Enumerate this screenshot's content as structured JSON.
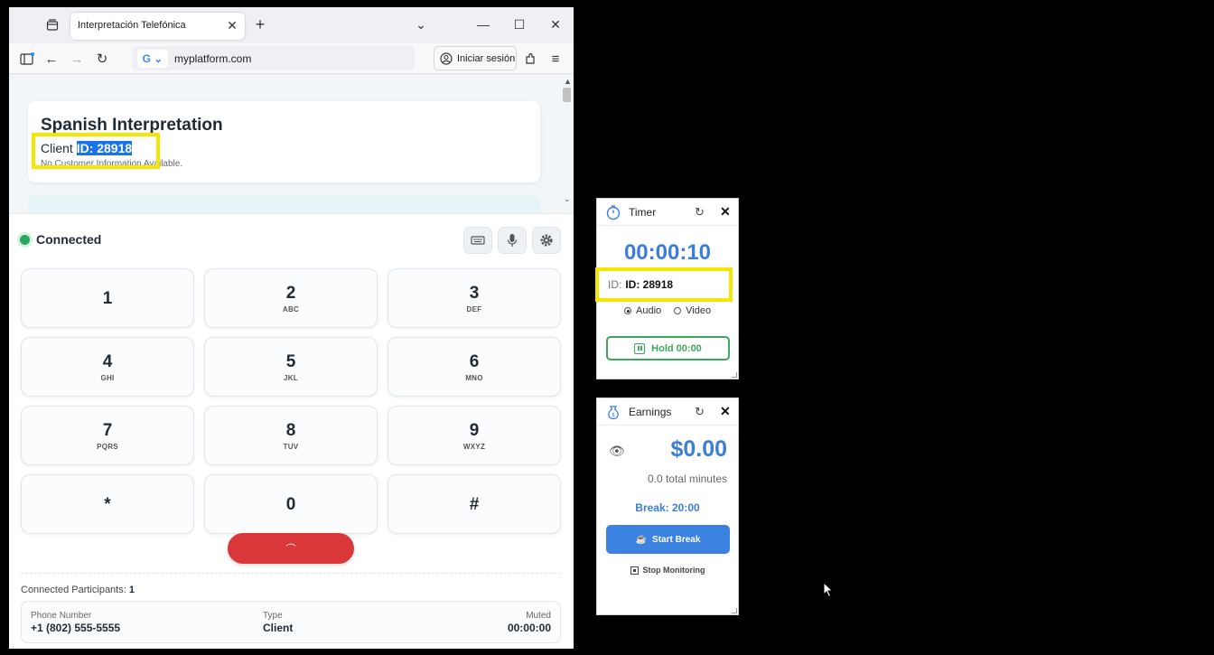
{
  "browser": {
    "tab_title": "Interpretación Telefónica",
    "url": "myplatform.com",
    "signin_label": "Iniciar sesión"
  },
  "page": {
    "title": "Spanish Interpretation",
    "client_prefix": "Client ",
    "client_id": "ID: 28918",
    "no_info": "No Customer Information Available."
  },
  "dialer": {
    "status": "Connected",
    "status_color": "#27a85f",
    "keys": [
      {
        "digit": "1",
        "letters": ""
      },
      {
        "digit": "2",
        "letters": "ABC"
      },
      {
        "digit": "3",
        "letters": "DEF"
      },
      {
        "digit": "4",
        "letters": "GHI"
      },
      {
        "digit": "5",
        "letters": "JKL"
      },
      {
        "digit": "6",
        "letters": "MNO"
      },
      {
        "digit": "7",
        "letters": "PQRS"
      },
      {
        "digit": "8",
        "letters": "TUV"
      },
      {
        "digit": "9",
        "letters": "WXYZ"
      },
      {
        "digit": "*",
        "letters": ""
      },
      {
        "digit": "0",
        "letters": ""
      },
      {
        "digit": "#",
        "letters": ""
      }
    ],
    "hangup_color": "#d9373a",
    "participants_label": "Connected Participants:",
    "participants_count": "1",
    "participant": {
      "phone_label": "Phone Number",
      "phone_value": "+1 (802) 555-5555",
      "type_label": "Type",
      "type_value": "Client",
      "muted_label": "Muted",
      "muted_value": "00:00:00"
    }
  },
  "timer": {
    "title": "Timer",
    "value": "00:00:10",
    "id_label": "ID:",
    "id_value": "ID: 28918",
    "audio_label": "Audio",
    "video_label": "Video",
    "hold_label": "Hold 00:00"
  },
  "earnings": {
    "title": "Earnings",
    "amount": "$0.00",
    "minutes": "0.0 total minutes",
    "break_label": "Break: 20:00",
    "start_break_label": "Start Break",
    "stop_monitoring_label": "Stop Monitoring"
  },
  "colors": {
    "accent_blue": "#3b7dd8",
    "hold_green": "#3aa65e",
    "highlight_yellow": "#f5e600"
  }
}
